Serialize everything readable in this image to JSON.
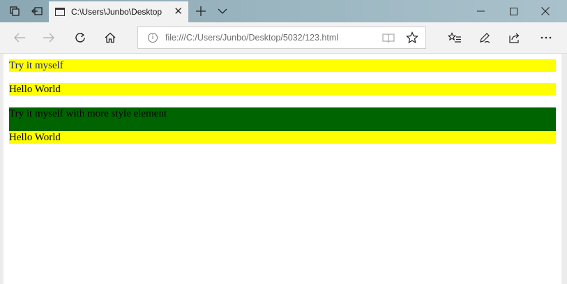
{
  "browser": {
    "tab_title": "C:\\Users\\Junbo\\Desktop",
    "address": "file:///C:/Users/Junbo/Desktop/5032/123.html",
    "title_bar_color": "#9db7c2"
  },
  "page": {
    "paragraphs": [
      {
        "text": "Try it myself",
        "background": "#ffff00"
      },
      {
        "text": "Hello World",
        "background": "#ffff00"
      },
      {
        "text": "Try it myself with more style element",
        "background": "#006400"
      },
      {
        "text": "Hello World",
        "background": "#ffff00"
      }
    ]
  },
  "icons": {
    "tab_manager": "tab-manager-icon",
    "set_aside_tabs": "set-aside-tabs-icon",
    "new_tab": "plus-icon",
    "tab_list": "chevron-down-icon",
    "minimize": "minimize-icon",
    "maximize": "maximize-icon",
    "close": "close-icon",
    "back": "back-arrow-icon",
    "forward": "forward-arrow-icon",
    "refresh": "refresh-icon",
    "home": "home-icon",
    "reading_view": "reading-view-icon",
    "favorite": "star-icon",
    "favorites_hub": "favorites-hub-icon",
    "notes": "pen-icon",
    "share": "share-icon",
    "more": "more-icon"
  }
}
